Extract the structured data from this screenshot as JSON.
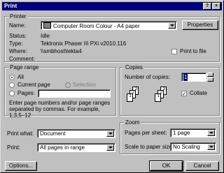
{
  "window": {
    "title": "Print"
  },
  "printer": {
    "group_label": "Printer",
    "name_label": "Name:",
    "name_value": "Computer Room Colour - A4 paper",
    "properties_label": "Properties",
    "status_label": "Status:",
    "status_value": "Idle",
    "type_label": "Type:",
    "type_value": "Tektronix Phaser III PXi v2010.116",
    "where_label": "Where:",
    "where_value": "\\\\smbhost\\tekta4",
    "comment_label": "Comment:",
    "print_to_file_label": "Print to file"
  },
  "page_range": {
    "group_label": "Page range",
    "all_label": "All",
    "current_label": "Current page",
    "selection_label": "Selection",
    "pages_label": "Pages:",
    "hint": "Enter page numbers and/or page ranges separated by commas. For example, 1,3,5–12"
  },
  "copies": {
    "group_label": "Copies",
    "number_label": "Number of copies:",
    "number_value": "1",
    "collate_label": "Collate"
  },
  "print_what": {
    "label": "Print what:",
    "value": "Document"
  },
  "print": {
    "label": "Print:",
    "value": "All pages in range"
  },
  "zoom": {
    "group_label": "Zoom",
    "pages_per_sheet_label": "Pages per sheet:",
    "pages_per_sheet_value": "1 page",
    "scale_label": "Scale to paper size:",
    "scale_value": "No Scaling"
  },
  "buttons": {
    "options": "Options...",
    "ok": "OK",
    "cancel": "Cancel"
  },
  "titlebar_buttons": {
    "help": "?",
    "close": "×"
  }
}
